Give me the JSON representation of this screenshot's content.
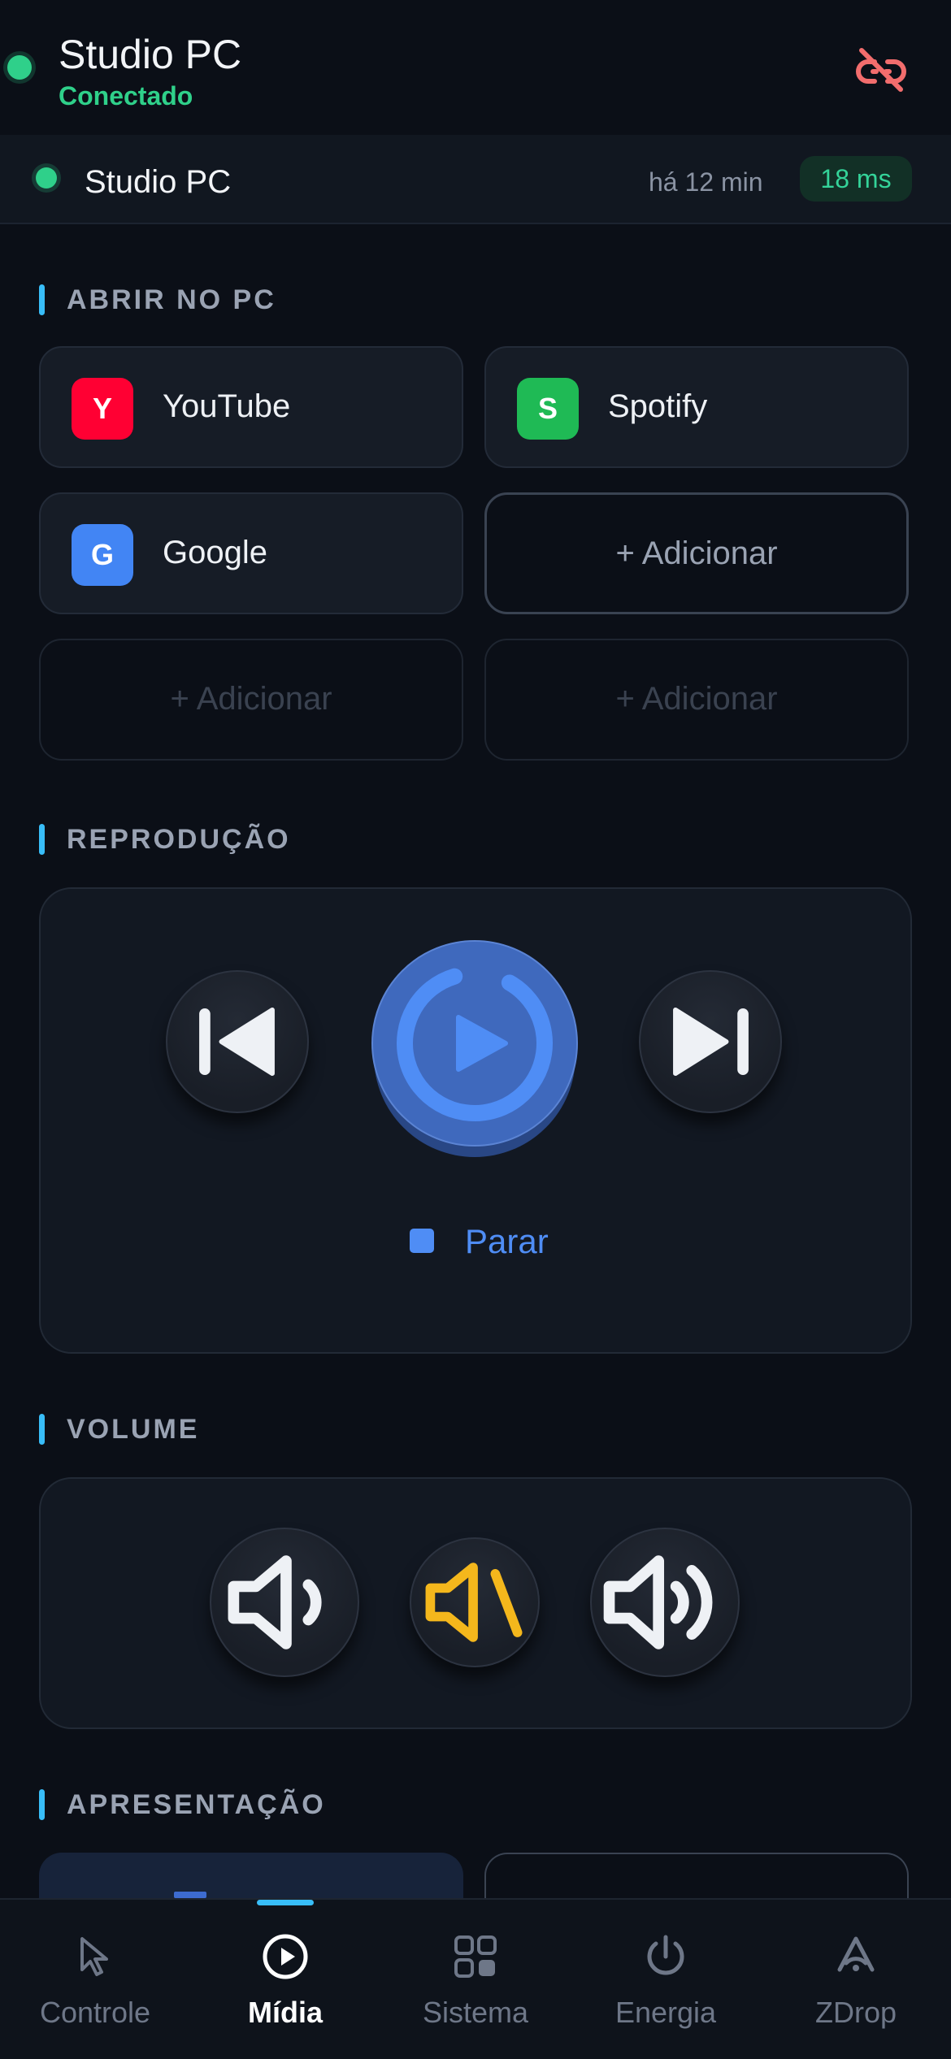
{
  "header": {
    "title": "Studio PC",
    "status": "Conectado",
    "status_color": "#2fd08a",
    "disconnect_icon": "link-off-icon"
  },
  "device": {
    "name": "Studio PC",
    "last_seen": "há 12 min",
    "latency": "18 ms"
  },
  "sections": {
    "open": "ABRIR NO PC",
    "playback": "REPRODUÇÃO",
    "volume": "VOLUME",
    "presentation": "APRESENTAÇÃO"
  },
  "shortcuts": [
    {
      "letter": "Y",
      "label": "YouTube",
      "color": "#ff0033"
    },
    {
      "letter": "S",
      "label": "Spotify",
      "color": "#1db954"
    },
    {
      "letter": "G",
      "label": "Google",
      "color": "#4285f4"
    }
  ],
  "add_label": "+ Adicionar",
  "playback": {
    "stop_label": "Parar",
    "accent": "#4f8df5"
  },
  "nav": {
    "items": [
      {
        "label": "Controle",
        "icon": "cursor-icon"
      },
      {
        "label": "Mídia",
        "icon": "play-circle-icon"
      },
      {
        "label": "Sistema",
        "icon": "grid-icon"
      },
      {
        "label": "Energia",
        "icon": "power-icon"
      },
      {
        "label": "ZDrop",
        "icon": "zdrop-icon"
      }
    ],
    "active": "Mídia"
  }
}
